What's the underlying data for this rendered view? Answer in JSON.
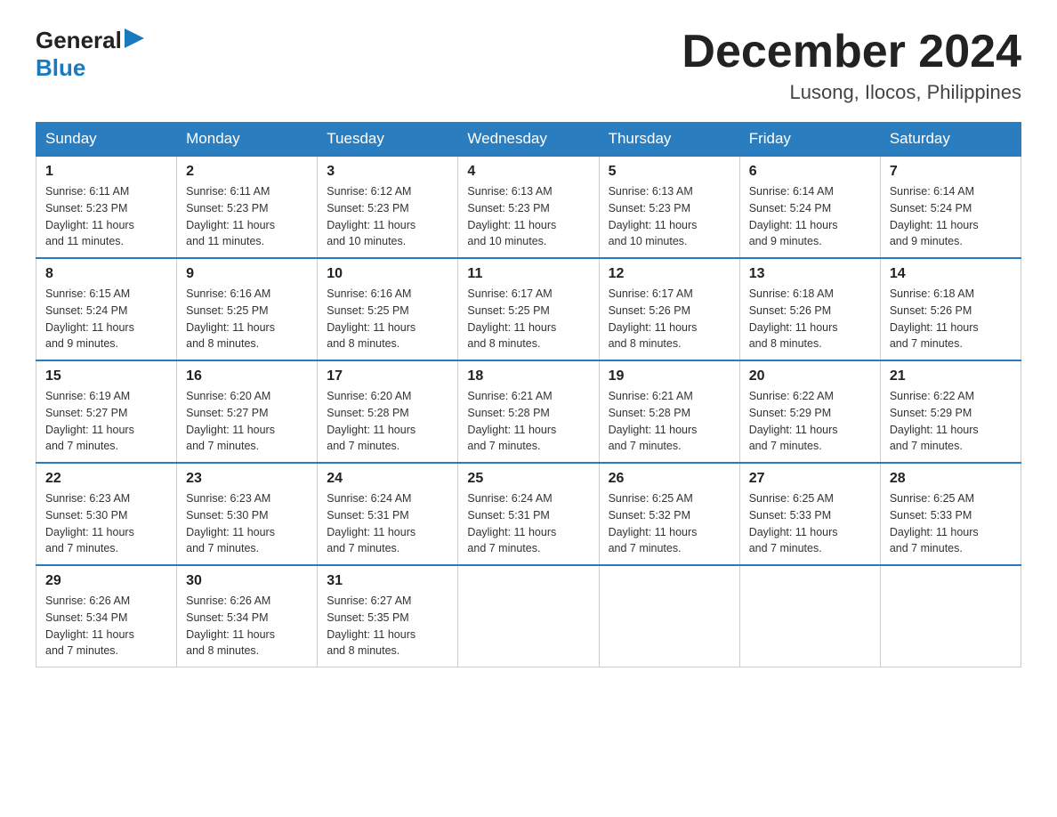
{
  "logo": {
    "text_general": "General",
    "text_blue": "Blue",
    "arrow_char": "▶"
  },
  "title": {
    "month_year": "December 2024",
    "location": "Lusong, Ilocos, Philippines"
  },
  "weekdays": [
    "Sunday",
    "Monday",
    "Tuesday",
    "Wednesday",
    "Thursday",
    "Friday",
    "Saturday"
  ],
  "weeks": [
    [
      {
        "day": "1",
        "sunrise": "6:11 AM",
        "sunset": "5:23 PM",
        "daylight": "11 hours and 11 minutes."
      },
      {
        "day": "2",
        "sunrise": "6:11 AM",
        "sunset": "5:23 PM",
        "daylight": "11 hours and 11 minutes."
      },
      {
        "day": "3",
        "sunrise": "6:12 AM",
        "sunset": "5:23 PM",
        "daylight": "11 hours and 10 minutes."
      },
      {
        "day": "4",
        "sunrise": "6:13 AM",
        "sunset": "5:23 PM",
        "daylight": "11 hours and 10 minutes."
      },
      {
        "day": "5",
        "sunrise": "6:13 AM",
        "sunset": "5:23 PM",
        "daylight": "11 hours and 10 minutes."
      },
      {
        "day": "6",
        "sunrise": "6:14 AM",
        "sunset": "5:24 PM",
        "daylight": "11 hours and 9 minutes."
      },
      {
        "day": "7",
        "sunrise": "6:14 AM",
        "sunset": "5:24 PM",
        "daylight": "11 hours and 9 minutes."
      }
    ],
    [
      {
        "day": "8",
        "sunrise": "6:15 AM",
        "sunset": "5:24 PM",
        "daylight": "11 hours and 9 minutes."
      },
      {
        "day": "9",
        "sunrise": "6:16 AM",
        "sunset": "5:25 PM",
        "daylight": "11 hours and 8 minutes."
      },
      {
        "day": "10",
        "sunrise": "6:16 AM",
        "sunset": "5:25 PM",
        "daylight": "11 hours and 8 minutes."
      },
      {
        "day": "11",
        "sunrise": "6:17 AM",
        "sunset": "5:25 PM",
        "daylight": "11 hours and 8 minutes."
      },
      {
        "day": "12",
        "sunrise": "6:17 AM",
        "sunset": "5:26 PM",
        "daylight": "11 hours and 8 minutes."
      },
      {
        "day": "13",
        "sunrise": "6:18 AM",
        "sunset": "5:26 PM",
        "daylight": "11 hours and 8 minutes."
      },
      {
        "day": "14",
        "sunrise": "6:18 AM",
        "sunset": "5:26 PM",
        "daylight": "11 hours and 7 minutes."
      }
    ],
    [
      {
        "day": "15",
        "sunrise": "6:19 AM",
        "sunset": "5:27 PM",
        "daylight": "11 hours and 7 minutes."
      },
      {
        "day": "16",
        "sunrise": "6:20 AM",
        "sunset": "5:27 PM",
        "daylight": "11 hours and 7 minutes."
      },
      {
        "day": "17",
        "sunrise": "6:20 AM",
        "sunset": "5:28 PM",
        "daylight": "11 hours and 7 minutes."
      },
      {
        "day": "18",
        "sunrise": "6:21 AM",
        "sunset": "5:28 PM",
        "daylight": "11 hours and 7 minutes."
      },
      {
        "day": "19",
        "sunrise": "6:21 AM",
        "sunset": "5:28 PM",
        "daylight": "11 hours and 7 minutes."
      },
      {
        "day": "20",
        "sunrise": "6:22 AM",
        "sunset": "5:29 PM",
        "daylight": "11 hours and 7 minutes."
      },
      {
        "day": "21",
        "sunrise": "6:22 AM",
        "sunset": "5:29 PM",
        "daylight": "11 hours and 7 minutes."
      }
    ],
    [
      {
        "day": "22",
        "sunrise": "6:23 AM",
        "sunset": "5:30 PM",
        "daylight": "11 hours and 7 minutes."
      },
      {
        "day": "23",
        "sunrise": "6:23 AM",
        "sunset": "5:30 PM",
        "daylight": "11 hours and 7 minutes."
      },
      {
        "day": "24",
        "sunrise": "6:24 AM",
        "sunset": "5:31 PM",
        "daylight": "11 hours and 7 minutes."
      },
      {
        "day": "25",
        "sunrise": "6:24 AM",
        "sunset": "5:31 PM",
        "daylight": "11 hours and 7 minutes."
      },
      {
        "day": "26",
        "sunrise": "6:25 AM",
        "sunset": "5:32 PM",
        "daylight": "11 hours and 7 minutes."
      },
      {
        "day": "27",
        "sunrise": "6:25 AM",
        "sunset": "5:33 PM",
        "daylight": "11 hours and 7 minutes."
      },
      {
        "day": "28",
        "sunrise": "6:25 AM",
        "sunset": "5:33 PM",
        "daylight": "11 hours and 7 minutes."
      }
    ],
    [
      {
        "day": "29",
        "sunrise": "6:26 AM",
        "sunset": "5:34 PM",
        "daylight": "11 hours and 7 minutes."
      },
      {
        "day": "30",
        "sunrise": "6:26 AM",
        "sunset": "5:34 PM",
        "daylight": "11 hours and 8 minutes."
      },
      {
        "day": "31",
        "sunrise": "6:27 AM",
        "sunset": "5:35 PM",
        "daylight": "11 hours and 8 minutes."
      },
      null,
      null,
      null,
      null
    ]
  ],
  "labels": {
    "sunrise": "Sunrise:",
    "sunset": "Sunset:",
    "daylight": "Daylight:"
  }
}
